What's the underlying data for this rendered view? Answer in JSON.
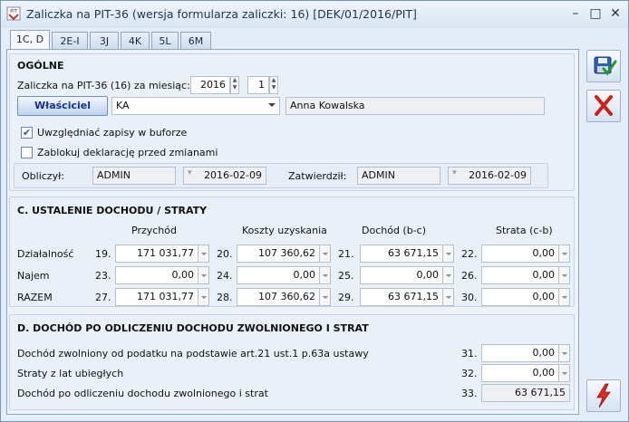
{
  "window": {
    "title": "Zaliczka na PIT-36 (wersja formularza zaliczki: 16) [DEK/01/2016/PIT]",
    "icon_text": "PIT",
    "minimize": "–",
    "maximize": "□",
    "close": "✕"
  },
  "tabs": [
    {
      "label": "1C, D"
    },
    {
      "label": "2E-I"
    },
    {
      "label": "3J"
    },
    {
      "label": "4K"
    },
    {
      "label": "5L"
    },
    {
      "label": "6M"
    }
  ],
  "ogolne": {
    "title": "OGÓLNE",
    "month_label": "Zaliczka na PIT-36 (16) za miesiąc:",
    "year": "2016",
    "month": "1",
    "owner_button": "Właściciel",
    "owner_code": "KA",
    "owner_name": "Anna Kowalska",
    "checkbox1_label": "Uwzględniać zapisy w buforze",
    "checkbox1_checked": true,
    "checkbox2_label": "Zablokuj deklarację przed zmianami",
    "checkbox2_checked": false,
    "obliczyl_label": "Obliczył:",
    "obliczyl_user": "ADMIN",
    "obliczyl_date": "2016-02-09",
    "zatwierdzil_label": "Zatwierdził:",
    "zatwierdzil_user": "ADMIN",
    "zatwierdzil_date": "2016-02-09"
  },
  "sectionC": {
    "title": "C. USTALENIE DOCHODU / STRATY",
    "headers": [
      "Przychód",
      "Koszty uzyskania",
      "Dochód (b-c)",
      "Strata (c-b)"
    ],
    "rows": [
      {
        "label": "Działalność",
        "cells": [
          {
            "num": "19.",
            "val": "171 031,77"
          },
          {
            "num": "20.",
            "val": "107 360,62"
          },
          {
            "num": "21.",
            "val": "63 671,15"
          },
          {
            "num": "22.",
            "val": "0,00"
          }
        ]
      },
      {
        "label": "Najem",
        "cells": [
          {
            "num": "23.",
            "val": "0,00"
          },
          {
            "num": "24.",
            "val": "0,00"
          },
          {
            "num": "25.",
            "val": "0,00"
          },
          {
            "num": "26.",
            "val": "0,00"
          }
        ]
      },
      {
        "label": "RAZEM",
        "cells": [
          {
            "num": "27.",
            "val": "171 031,77"
          },
          {
            "num": "28.",
            "val": "107 360,62"
          },
          {
            "num": "29.",
            "val": "63 671,15"
          },
          {
            "num": "30.",
            "val": "0,00"
          }
        ]
      }
    ]
  },
  "sectionD": {
    "title": "D. DOCHÓD PO ODLICZENIU DOCHODU ZWOLNIONEGO I STRAT",
    "rows": [
      {
        "label": "Dochód zwolniony od podatku na podstawie art.21 ust.1 p.63a ustawy",
        "num": "31.",
        "val": "0,00"
      },
      {
        "label": "Straty z lat ubiegłych",
        "num": "32.",
        "val": "0,00"
      },
      {
        "label": "Dochód po odliczeniu dochodu zwolnionego i strat",
        "num": "33.",
        "val": "63 671,15"
      }
    ]
  },
  "toolbar": {
    "save_icon": "save-icon",
    "cancel_icon": "cancel-icon",
    "calc_icon": "lightning-icon"
  }
}
